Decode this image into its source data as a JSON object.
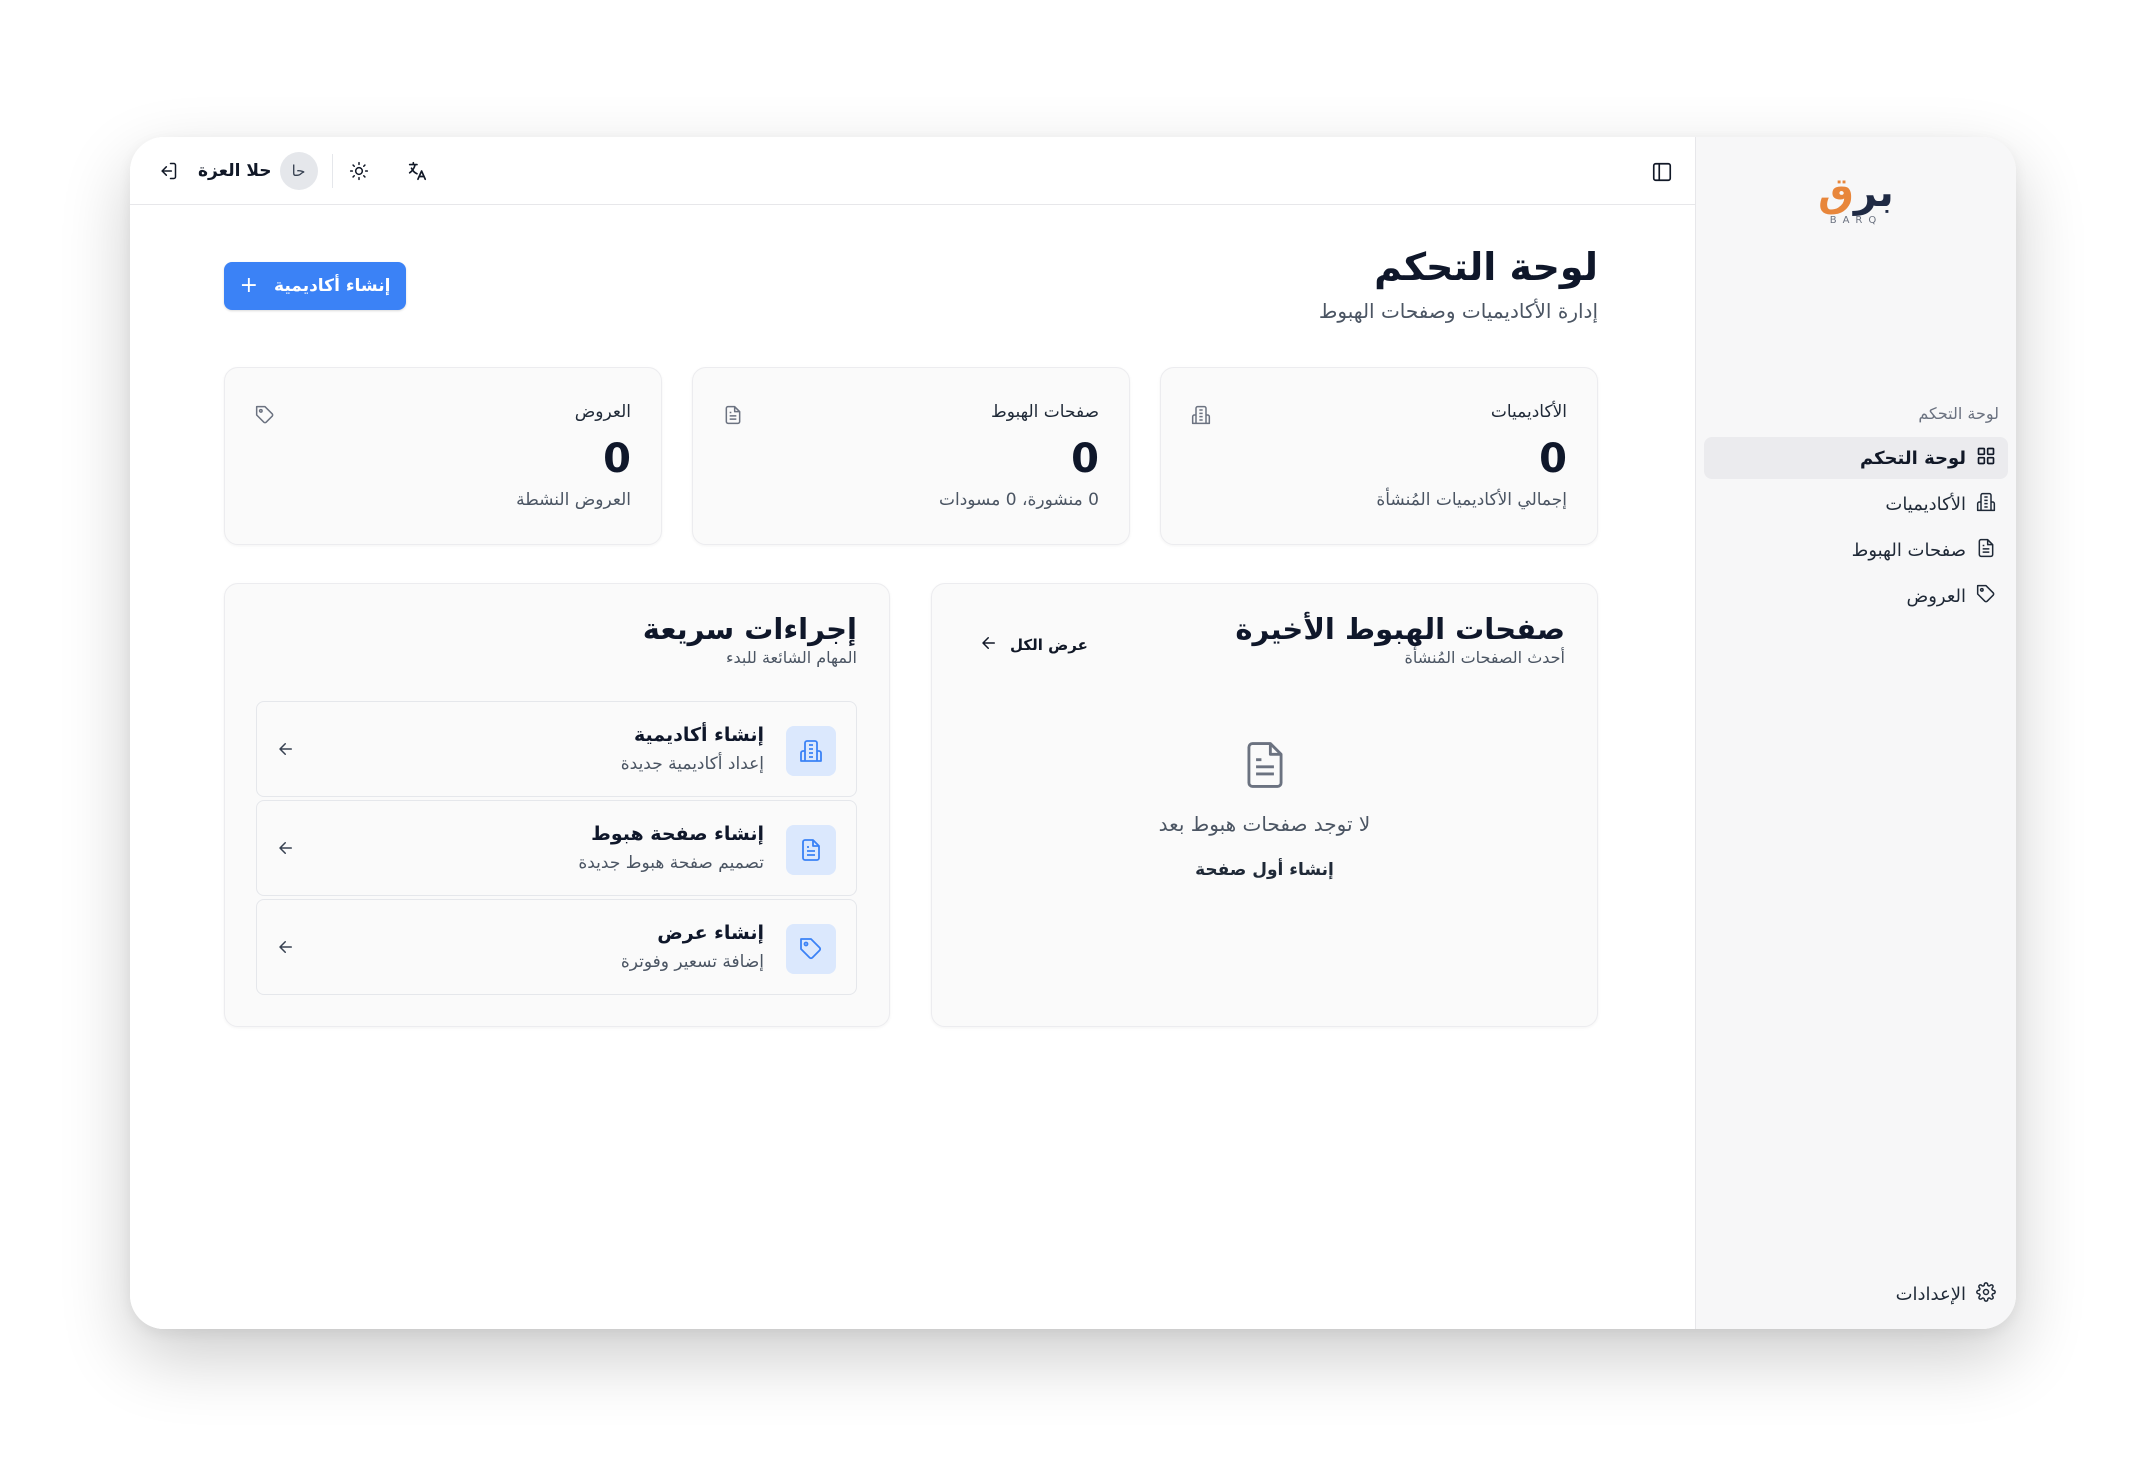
{
  "brand": {
    "logo_text_main": "بر",
    "logo_text_accent": "ق",
    "logo_sub": "BARQ"
  },
  "sidebar": {
    "group_label": "لوحة التحكم",
    "items": [
      {
        "label": "لوحة التحكم",
        "icon": "dashboard-grid-icon",
        "active": true
      },
      {
        "label": "الأكاديميات",
        "icon": "building-icon",
        "active": false
      },
      {
        "label": "صفحات الهبوط",
        "icon": "file-text-icon",
        "active": false
      },
      {
        "label": "العروض",
        "icon": "tag-icon",
        "active": false
      }
    ],
    "settings_label": "الإعدادات"
  },
  "topbar": {
    "user_name": "حلا العزة",
    "avatar_initials": "حا"
  },
  "header": {
    "title": "لوحة التحكم",
    "subtitle": "إدارة الأكاديميات وصفحات الهبوط",
    "create_button": "إنشاء أكاديمية"
  },
  "stats": [
    {
      "label": "الأكاديميات",
      "value": "0",
      "note": "إجمالي الأكاديميات المُنشأة",
      "icon": "building-icon"
    },
    {
      "label": "صفحات الهبوط",
      "value": "0",
      "note": "0 منشورة، 0 مسودات",
      "icon": "file-text-icon"
    },
    {
      "label": "العروض",
      "value": "0",
      "note": "العروض النشطة",
      "icon": "tag-icon"
    }
  ],
  "recent": {
    "title": "صفحات الهبوط الأخيرة",
    "subtitle": "أحدث الصفحات المُنشأة",
    "view_all": "عرض الكل",
    "empty_text": "لا توجد صفحات هبوط بعد",
    "empty_link": "إنشاء أول صفحة"
  },
  "quick": {
    "title": "إجراءات سريعة",
    "subtitle": "المهام الشائعة للبدء",
    "items": [
      {
        "title": "إنشاء أكاديمية",
        "sub": "إعداد أكاديمية جديدة",
        "icon": "building-icon"
      },
      {
        "title": "إنشاء صفحة هبوط",
        "sub": "تصميم صفحة هبوط جديدة",
        "icon": "file-text-icon"
      },
      {
        "title": "إنشاء عرض",
        "sub": "إضافة تسعير وفوترة",
        "icon": "tag-icon"
      }
    ]
  },
  "colors": {
    "primary": "#3b82f6",
    "icon_bg": "#dbe8fd",
    "sidebar_bg": "#f7f7f8",
    "logo_accent": "#e8863b"
  }
}
